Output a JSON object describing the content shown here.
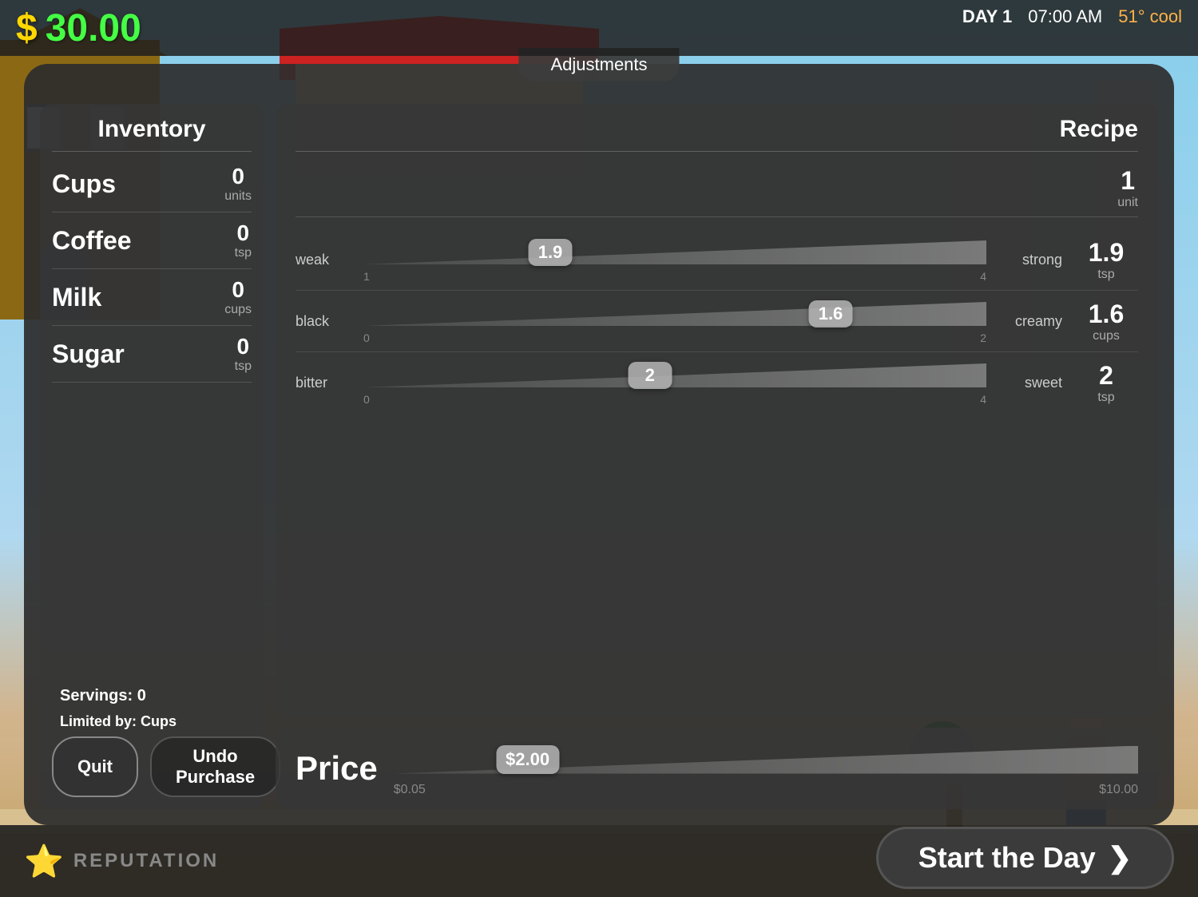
{
  "header": {
    "dollar_sign": "$",
    "balance": "30.00",
    "day_label": "DAY",
    "day_number": "1",
    "time": "07:00 AM",
    "temperature": "51°",
    "weather": "cool"
  },
  "adjustments_tab": {
    "label": "Adjustments"
  },
  "inventory": {
    "title": "Inventory",
    "items": [
      {
        "name": "Cups",
        "qty": "0",
        "unit": "units"
      },
      {
        "name": "Coffee",
        "qty": "0",
        "unit": "tsp"
      },
      {
        "name": "Milk",
        "qty": "0",
        "unit": "cups"
      },
      {
        "name": "Sugar",
        "qty": "0",
        "unit": "tsp"
      }
    ]
  },
  "recipe": {
    "title": "Recipe",
    "cups_qty": "1",
    "cups_unit": "unit",
    "sliders": [
      {
        "label_left": "weak",
        "label_right": "strong",
        "value": "1.9",
        "unit": "tsp",
        "min": "1",
        "max": "4",
        "thumb_pct": 30
      },
      {
        "label_left": "black",
        "label_right": "creamy",
        "value": "1.6",
        "unit": "cups",
        "min": "0",
        "max": "2",
        "thumb_pct": 75
      },
      {
        "label_left": "bitter",
        "label_right": "sweet",
        "value": "2",
        "unit": "tsp",
        "min": "0",
        "max": "4",
        "thumb_pct": 46
      }
    ]
  },
  "price": {
    "label": "Price",
    "value": "$2.00",
    "min": "$0.05",
    "max": "$10.00",
    "thumb_pct": 18
  },
  "bottom": {
    "servings_label": "Servings:",
    "servings_count": "0",
    "limited_label": "Limited by:",
    "limited_item": "Cups"
  },
  "buttons": {
    "quit_label": "Quit",
    "undo_label": "Undo Purchase"
  },
  "footer": {
    "reputation_label": "REPUTATION"
  },
  "start_day": {
    "label": "Start the Day",
    "arrow": "❯"
  }
}
